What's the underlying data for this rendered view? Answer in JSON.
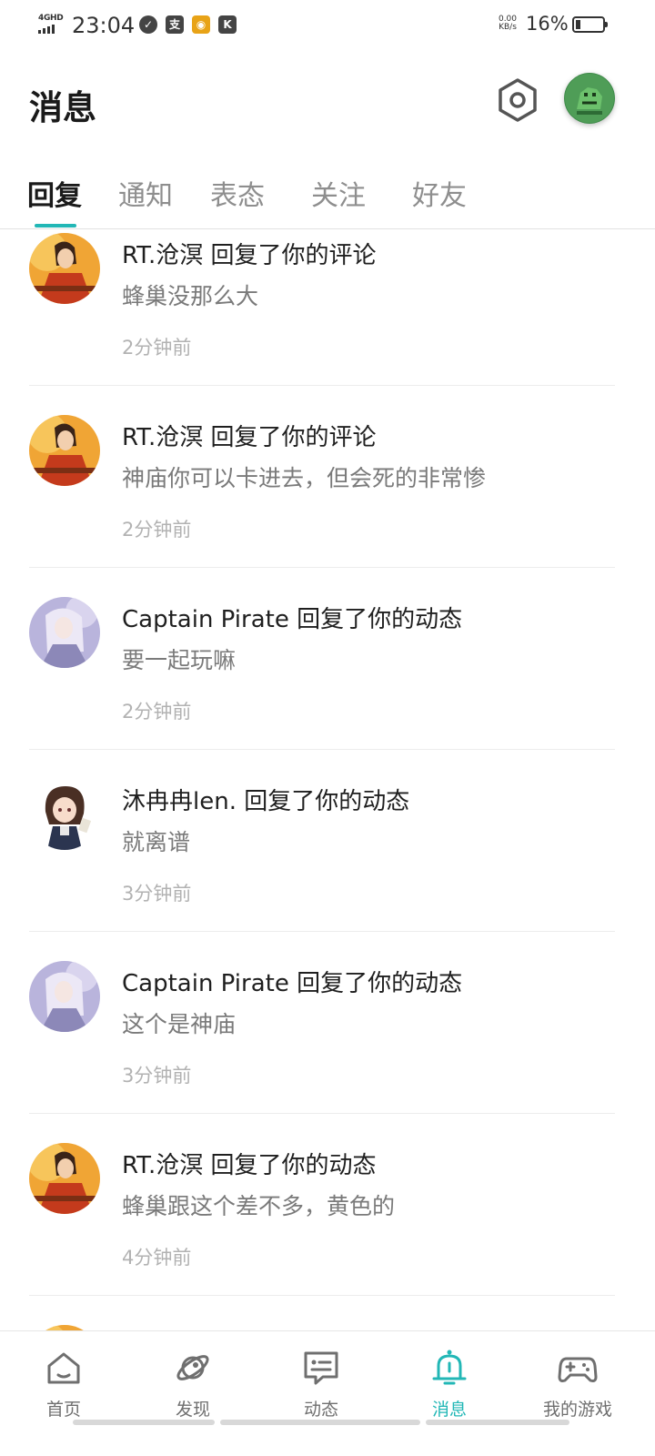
{
  "status_bar": {
    "network": "4GHD",
    "time": "23:04",
    "icons": [
      "check-circle-icon",
      "alipay-icon",
      "game-app-icon",
      "k-app-icon"
    ],
    "alipay_glyph": "支",
    "k_glyph": "K",
    "speed_value": "0.00",
    "speed_unit": "KB/s",
    "battery_percent": "16%"
  },
  "header": {
    "title": "消息",
    "settings_icon": "gear-icon",
    "avatar": "user-avatar"
  },
  "tabs": [
    {
      "label": "回复",
      "active": true
    },
    {
      "label": "通知",
      "active": false
    },
    {
      "label": "表态",
      "active": false
    },
    {
      "label": "关注",
      "active": false
    },
    {
      "label": "好友",
      "active": false
    }
  ],
  "accent_color": "#22b7b6",
  "messages": [
    {
      "title": "RT.沧溟 回复了你的评论",
      "content": "蜂巢没那么大",
      "time": "2分钟前",
      "avatar": "warrior-avatar"
    },
    {
      "title": "RT.沧溟 回复了你的评论",
      "content": "神庙你可以卡进去，但会死的非常惨",
      "time": "2分钟前",
      "avatar": "warrior-avatar"
    },
    {
      "title": "Captain Pirate 回复了你的动态",
      "content": "要一起玩嘛",
      "time": "2分钟前",
      "avatar": "anime-girl-avatar"
    },
    {
      "title": "沐冉冉len. 回复了你的动态",
      "content": "就离谱",
      "time": "3分钟前",
      "avatar": "chibi-avatar"
    },
    {
      "title": "Captain Pirate 回复了你的动态",
      "content": "这个是神庙",
      "time": "3分钟前",
      "avatar": "anime-girl-avatar"
    },
    {
      "title": "RT.沧溟 回复了你的动态",
      "content": "蜂巢跟这个差不多，黄色的",
      "time": "4分钟前",
      "avatar": "warrior-avatar"
    }
  ],
  "bottom_nav": [
    {
      "label": "首页",
      "icon": "home-icon",
      "active": false
    },
    {
      "label": "发现",
      "icon": "planet-icon",
      "active": false
    },
    {
      "label": "动态",
      "icon": "chat-bubble-icon",
      "active": false
    },
    {
      "label": "消息",
      "icon": "bell-icon",
      "active": true
    },
    {
      "label": "我的游戏",
      "icon": "gamepad-icon",
      "active": false
    }
  ]
}
